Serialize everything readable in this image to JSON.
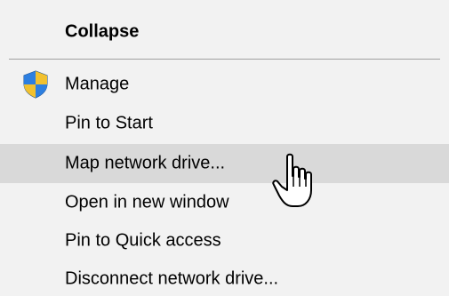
{
  "context_menu": {
    "items": [
      {
        "label": "Collapse"
      },
      {
        "label": "Manage",
        "icon": "uac-shield-icon"
      },
      {
        "label": "Pin to Start"
      },
      {
        "label": "Map network drive..."
      },
      {
        "label": "Open in new window"
      },
      {
        "label": "Pin to Quick access"
      },
      {
        "label": "Disconnect network drive..."
      }
    ],
    "highlighted_item": "Map network drive...",
    "cursor": "hand-pointer-icon"
  },
  "colors": {
    "menu_background": "#f2f2f2",
    "highlight": "#d9d9d9",
    "separator": "#a0a0a0",
    "shield_blue": "#1f6fd1",
    "shield_yellow": "#f2c12e"
  }
}
